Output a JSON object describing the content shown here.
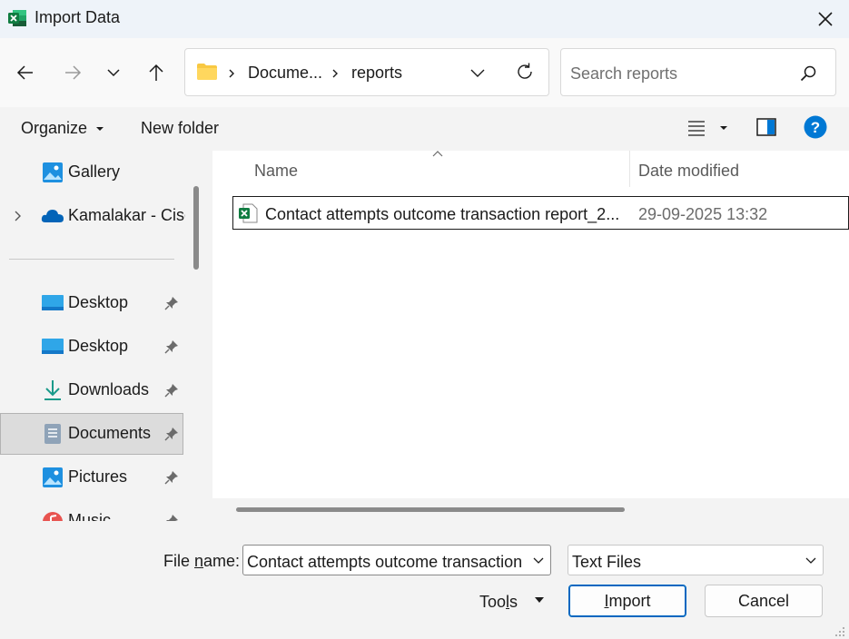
{
  "window": {
    "title": "Import Data"
  },
  "address": {
    "crumbs": [
      "Docume...",
      "reports"
    ]
  },
  "search": {
    "placeholder": "Search reports"
  },
  "toolbar": {
    "organize_label": "Organize",
    "new_folder_label": "New folder"
  },
  "sidebar": {
    "items": [
      {
        "label": "Gallery"
      },
      {
        "label": "Kamalakar - Cisc"
      },
      {
        "label": "Desktop"
      },
      {
        "label": "Desktop"
      },
      {
        "label": "Downloads"
      },
      {
        "label": "Documents"
      },
      {
        "label": "Pictures"
      },
      {
        "label": "Music"
      }
    ]
  },
  "columns": {
    "name": "Name",
    "date_modified": "Date modified"
  },
  "files": [
    {
      "name": "Contact attempts outcome transaction report_2...",
      "date": "29-09-2025 13:32"
    }
  ],
  "bottom": {
    "file_name_label_pre": "File ",
    "file_name_label_key": "n",
    "file_name_label_post": "ame:",
    "file_name_value": "Contact attempts outcome transaction",
    "file_type_value": "Text Files",
    "tools_pre": "Too",
    "tools_key": "l",
    "tools_post": "s",
    "import_key": "I",
    "import_post": "mport",
    "cancel_label": "Cancel"
  },
  "colors": {
    "accent": "#0067c0",
    "excel_green": "#107c41",
    "help_blue": "#0078d4",
    "onedrive_blue": "#0364b8"
  }
}
